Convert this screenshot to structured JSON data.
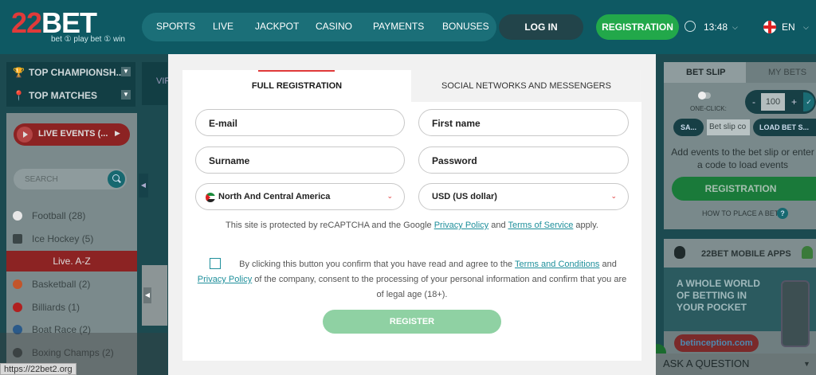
{
  "brand": {
    "logo_text_num": "22",
    "logo_text_word": "BET",
    "tagline": "bet ① play  bet ① win"
  },
  "nav": {
    "items": [
      "SPORTS",
      "LIVE",
      "JACKPOT",
      "CASINO",
      "PAYMENTS",
      "BONUSES"
    ]
  },
  "header": {
    "login_label": "LOG IN",
    "registration_label": "REGISTRATION",
    "time": "13:48",
    "language": "EN"
  },
  "left_sidebar": {
    "top_championships": "TOP CHAMPIONSH...",
    "top_matches": "TOP MATCHES",
    "live_events": "LIVE EVENTS (...",
    "search_placeholder": "SEARCH",
    "live_az": "Live. A-Z",
    "sports": [
      {
        "label": "Football (28)",
        "color": "#e7e7e7"
      },
      {
        "label": "Ice Hockey (5)",
        "color": "#3b4647"
      },
      {
        "label": "Basketball (2)",
        "color": "#c2552a"
      },
      {
        "label": "Billiards (1)",
        "color": "#b02020"
      },
      {
        "label": "Boat Race (2)",
        "color": "#2a5a8a"
      },
      {
        "label": "Boxing Champs (2)",
        "color": "#3b4647"
      }
    ]
  },
  "center": {
    "vi_text": "VIR"
  },
  "status_bar": {
    "url": "https://22bet2.org"
  },
  "bet_slip": {
    "tab_active": "BET SLIP",
    "tab_other": "MY BETS",
    "one_click": "ONE-CLICK:",
    "stake_minus": "-",
    "stake_value": "100",
    "stake_plus": "+",
    "stake_ok": "✓",
    "save_label": "SA...",
    "code_placeholder": "Bet slip co",
    "load_label": "LOAD BET S...",
    "add_events_line1": "Add events to the bet slip or enter",
    "add_events_line2": "a code to load events",
    "registration_label": "REGISTRATION",
    "how_to": "HOW TO PLACE A BET",
    "help_glyph": "?"
  },
  "mobile_apps": {
    "title": "22BET MOBILE APPS",
    "promo_line1": "A WHOLE WORLD",
    "promo_line2": "OF BETTING IN",
    "promo_line3": "YOUR POCKET",
    "promo_bar": "betinception.com"
  },
  "ask_question": {
    "label": "ASK A QUESTION"
  },
  "modal": {
    "tab_full": "FULL REGISTRATION",
    "tab_social": "SOCIAL NETWORKS AND MESSENGERS",
    "fields": {
      "email": "E-mail",
      "first_name": "First name",
      "surname": "Surname",
      "password": "Password",
      "region": "North And Central America",
      "currency": "USD (US dollar)"
    },
    "captcha_pre": "This site is protected by reCAPTCHA and the Google ",
    "captcha_privacy": "Privacy Policy",
    "captcha_and": " and ",
    "captcha_terms": "Terms of Service",
    "captcha_post": " apply.",
    "consent_pre": "By clicking this button you confirm that you have read and agree to the ",
    "consent_terms": "Terms and Conditions",
    "consent_and": " and ",
    "consent_privacy": "Privacy Policy",
    "consent_post": " of the company, consent to the processing of your personal information and confirm that you are of legal age (18+).",
    "register_label": "REGISTER"
  },
  "colors": {
    "header_bg": "#0e5963",
    "accent_green": "#22a84a",
    "accent_red": "#e03a3a",
    "link": "#1e8f9b",
    "register_disabled": "#8fd1a3"
  }
}
